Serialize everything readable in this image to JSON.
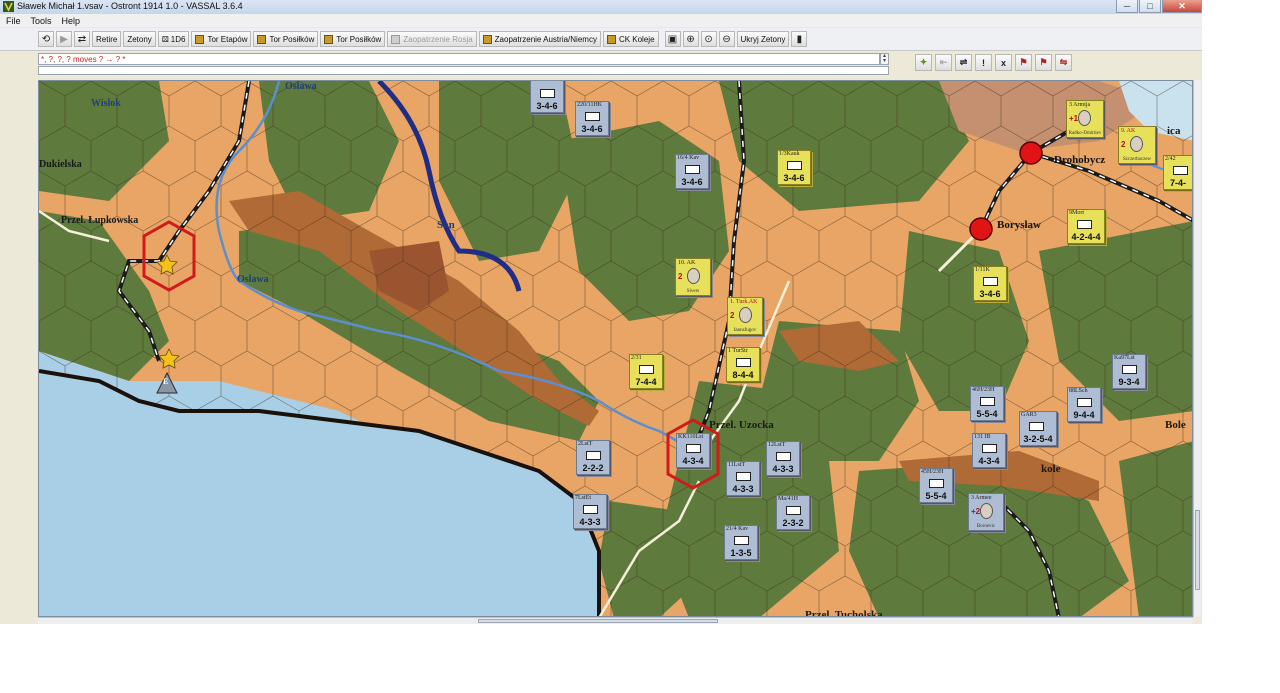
{
  "window": {
    "title": "Sławek Michał 1.vsav - Ostront 1914 1.0 - VASSAL 3.6.4",
    "minimize_glyph": "─",
    "maximize_glyph": "□",
    "close_glyph": "✕"
  },
  "menu": [
    "File",
    "Tools",
    "Help"
  ],
  "toolbar": {
    "retire": "Retire",
    "zetony": "Zetony",
    "die": "1D6",
    "tor_etapow": "Tor Etapów",
    "tor_posilkow_1": "Tor Posiłków",
    "tor_posilkow_2": "Tor Posiłków",
    "zaopatrzenie_rosja": "Zaopatrzenie Rosja",
    "zaopatrzenie_austria": "Zaopatrzenie Austria/Niemcy",
    "ck_koleje": "CK Koleje",
    "ukryj": "Ukryj Zetony"
  },
  "chat": {
    "log_text": "*, ?, ?, ? moves ? → ? *"
  },
  "map": {
    "labels": {
      "wislok": "Wisłok",
      "dukielska": "Dukielska",
      "lupkowska": "Przel. Łupkowska",
      "oslawa_top": "Osława",
      "oslawa": "Osława",
      "san": "San",
      "uzocka": "Przel. Uzocka",
      "tucholska": "Przel. Tucholska",
      "drohobycz": "Drohobycz",
      "boryslaw": "Borysław",
      "bole": "Bole",
      "kole": "kole",
      "ica": "ica",
      "e_marker": "E"
    },
    "counters": [
      {
        "id": "c1",
        "side": "at",
        "label": "",
        "strength": "3-4-6"
      },
      {
        "id": "c2",
        "side": "at",
        "label": "220/11HK",
        "strength": "3-4-6"
      },
      {
        "id": "c3",
        "side": "at",
        "label": "16/4 Kav",
        "strength": "3-4-6"
      },
      {
        "id": "c4",
        "side": "ru",
        "label": "1/3Kauk",
        "strength": "3-4-6"
      },
      {
        "id": "c5",
        "side": "ru",
        "label": "2/31",
        "strength": "7-4-4"
      },
      {
        "id": "c6",
        "side": "ru",
        "label": "1 TurStr",
        "strength": "8-4-4"
      },
      {
        "id": "c7",
        "side": "ru",
        "label": "1/11K",
        "strength": "3-4-6"
      },
      {
        "id": "c8",
        "side": "ru",
        "label": "9Mort",
        "strength": "4-2-4-4"
      },
      {
        "id": "c9",
        "side": "ru",
        "label": "2/42",
        "strength": "7-4-"
      },
      {
        "id": "c10",
        "side": "at",
        "label": "KK110Lst",
        "strength": "4-3-4"
      },
      {
        "id": "c11",
        "side": "at",
        "label": "2LstT",
        "strength": "2-2-2"
      },
      {
        "id": "c12",
        "side": "at",
        "label": "7LstEt",
        "strength": "4-3-3"
      },
      {
        "id": "c13",
        "side": "at",
        "label": "11LstT",
        "strength": "4-3-3"
      },
      {
        "id": "c14",
        "side": "at",
        "label": "12LstT",
        "strength": "4-3-3"
      },
      {
        "id": "c15",
        "side": "at",
        "label": "Ma/41H",
        "strength": "2-3-2"
      },
      {
        "id": "c16",
        "side": "at",
        "label": "21/4 Kav",
        "strength": "1-3-5"
      },
      {
        "id": "c17",
        "side": "at",
        "label": "46H/23H",
        "strength": "5-5-4"
      },
      {
        "id": "c18",
        "side": "at",
        "label": "131 IB",
        "strength": "4-3-4"
      },
      {
        "id": "c19",
        "side": "at",
        "label": "GAR3",
        "strength": "3-2-5-4"
      },
      {
        "id": "c20",
        "side": "at",
        "label": "88LSch",
        "strength": "9-4-4"
      },
      {
        "id": "c21",
        "side": "at",
        "label": "Ka97Lst",
        "strength": "9-3-4"
      },
      {
        "id": "c22",
        "side": "at",
        "label": "45H/23H",
        "strength": "5-5-4"
      }
    ],
    "hqs": [
      {
        "id": "h1",
        "side": "ru",
        "label": "10. AK",
        "modifier": "2",
        "name": "Sivers"
      },
      {
        "id": "h2",
        "side": "ru",
        "label": "1. Turk.AK",
        "modifier": "2",
        "name": "Iannsfugov"
      },
      {
        "id": "h3",
        "side": "ru",
        "label": "3 Armija",
        "modifier": "+1",
        "name": "Radko-Dmitriev"
      },
      {
        "id": "h4",
        "side": "ru",
        "label": "9. AK",
        "modifier": "2",
        "name": "Szczerbaczew"
      },
      {
        "id": "h5",
        "side": "at",
        "label": "3 Armee",
        "modifier": "+2",
        "name": "Boroevic"
      }
    ]
  }
}
